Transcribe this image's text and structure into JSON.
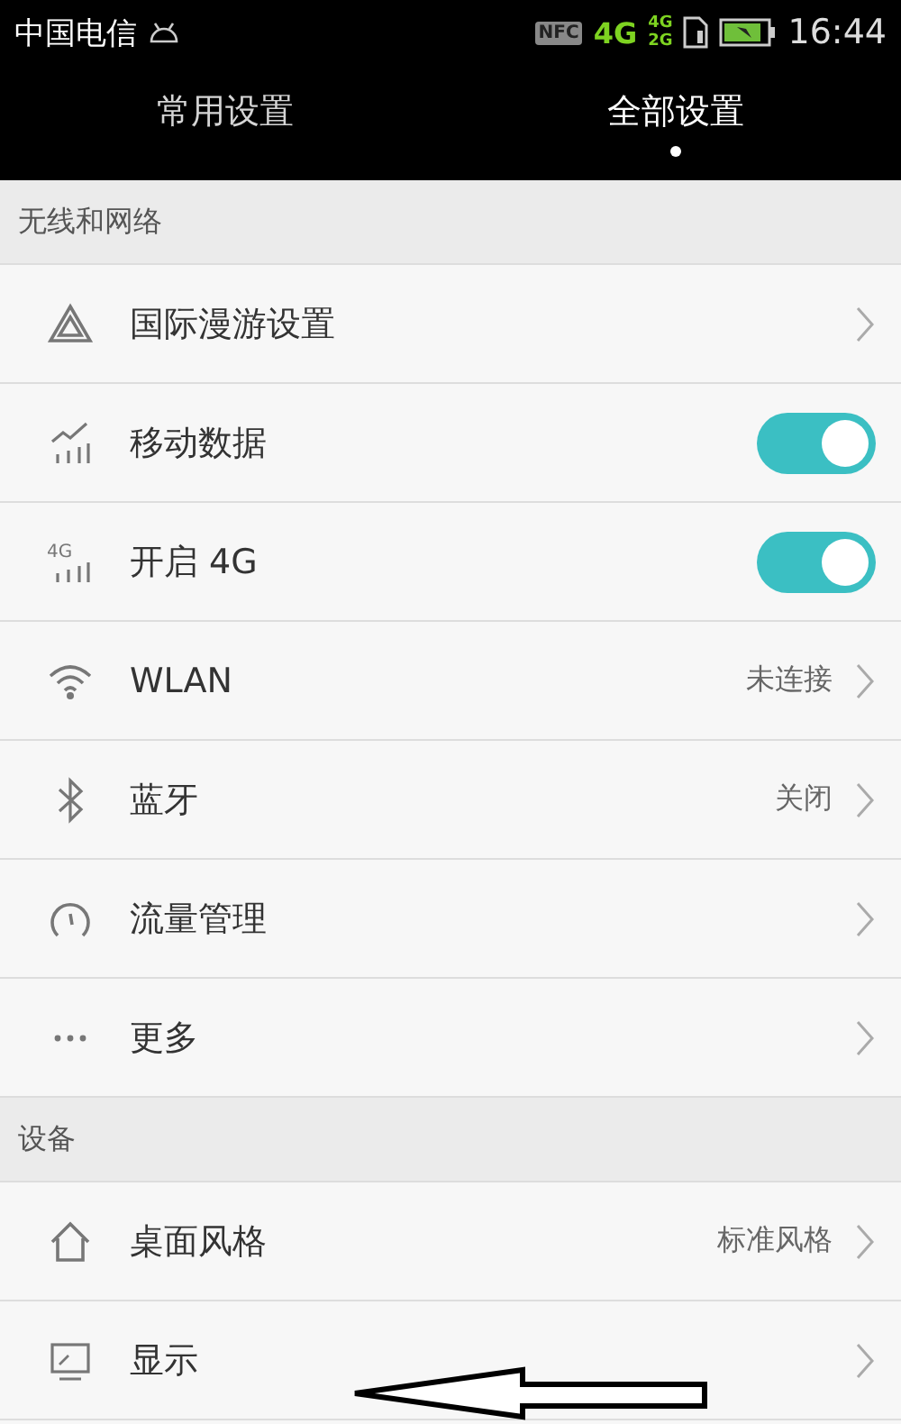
{
  "status_bar": {
    "carrier": "中国电信",
    "nfc": "NFC",
    "network": "4G",
    "sim_1": "4G",
    "sim_2": "2G",
    "time": "16:44"
  },
  "tabs": [
    {
      "label": "常用设置",
      "selected": false
    },
    {
      "label": "全部设置",
      "selected": true
    }
  ],
  "sections": [
    {
      "header": "无线和网络",
      "items": [
        {
          "label": "国际漫游设置",
          "kind": "link"
        },
        {
          "label": "移动数据",
          "kind": "toggle",
          "on": true
        },
        {
          "icon_text": "4G",
          "label": "开启 4G",
          "kind": "toggle",
          "on": true
        },
        {
          "label": "WLAN",
          "kind": "link",
          "value": "未连接"
        },
        {
          "label": "蓝牙",
          "kind": "link",
          "value": "关闭"
        },
        {
          "label": "流量管理",
          "kind": "link"
        },
        {
          "label": "更多",
          "kind": "link"
        }
      ]
    },
    {
      "header": "设备",
      "items": [
        {
          "label": "桌面风格",
          "kind": "link",
          "value": "标准风格"
        },
        {
          "label": "显示",
          "kind": "link"
        }
      ]
    }
  ],
  "annotation": {
    "kind": "arrow"
  }
}
